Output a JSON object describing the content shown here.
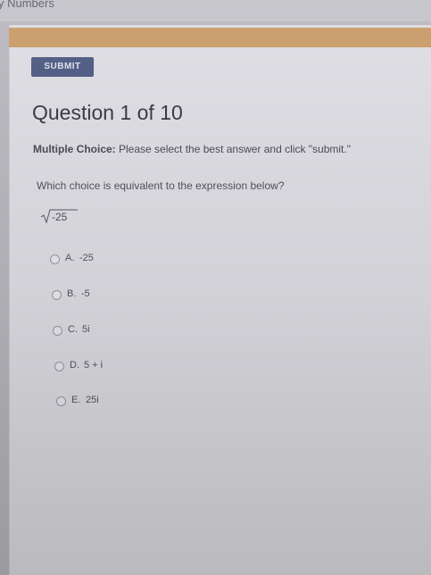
{
  "breadcrumb": "y Numbers",
  "submit_label": "SUBMIT",
  "question": {
    "title": "Question 1 of 10",
    "type_label": "Multiple Choice:",
    "instructions": " Please select the best answer and click \"submit.\"",
    "prompt": "Which choice is equivalent to the expression below?",
    "expression_radicand": "-25"
  },
  "choices": [
    {
      "letter": "A.",
      "text": "-25"
    },
    {
      "letter": "B.",
      "text": "-5"
    },
    {
      "letter": "C.",
      "text": "5i"
    },
    {
      "letter": "D.",
      "text": "5 + i"
    },
    {
      "letter": "E.",
      "text": "25i"
    }
  ],
  "colors": {
    "accent_band": "#c89a64",
    "submit_button": "#4a5680"
  }
}
